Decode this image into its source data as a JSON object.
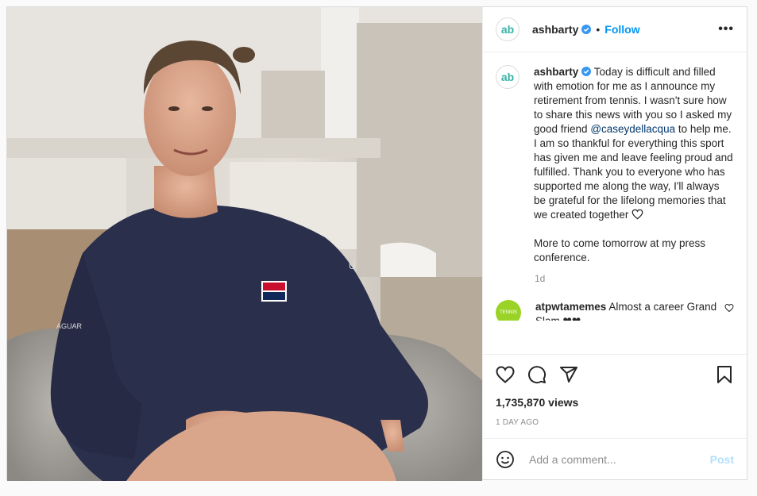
{
  "post": {
    "username": "ashbarty",
    "avatar_text": "ab",
    "follow_label": "Follow",
    "separator": "•",
    "more_label": "•••",
    "caption_before_mention": "Today is difficult and filled with emotion for me as I announce my retirement from tennis. I wasn't sure how to share this news with you so I asked my good friend ",
    "mention": "@caseydellacqua",
    "caption_after_mention": " to help me. I am so thankful for everything this sport has given me and leave feeling proud and fulfilled. Thank you to everyone who has supported me along the way, I'll always be grateful for the lifelong memories that we created together",
    "caption_second_paragraph": "More to come tomorrow at my press conference.",
    "caption_age": "1d",
    "comment": {
      "username": "atpwtamemes",
      "text": "Almost a career Grand Slam ❤❤",
      "avatar_text": "TENNIS"
    },
    "views": "1,735,870 views",
    "date": "1 DAY AGO",
    "add_comment_placeholder": "Add a comment...",
    "post_button": "Post"
  },
  "colors": {
    "accent_blue": "#0095f6",
    "post_button_disabled": "#b2dffc",
    "avatar_teal": "#38b2a6",
    "mention_blue": "#00376b"
  },
  "icons": {
    "verified": "verified-badge-icon",
    "like": "heart-icon",
    "comment": "comment-bubble-icon",
    "share": "paper-plane-icon",
    "save": "bookmark-icon",
    "emoji": "smiley-icon"
  }
}
